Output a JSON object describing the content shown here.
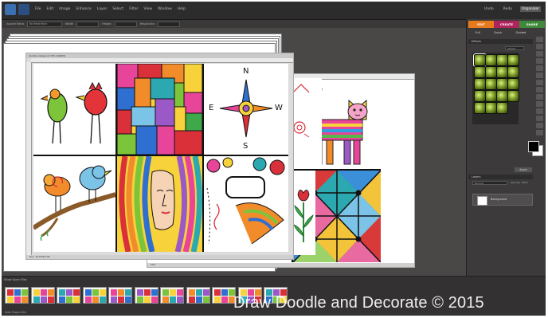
{
  "menu": {
    "items": [
      "File",
      "Edit",
      "Image",
      "Enhance",
      "Layer",
      "Select",
      "Filter",
      "View",
      "Window",
      "Help"
    ],
    "right": [
      "Undo",
      "Redo",
      "Organizer"
    ]
  },
  "options": {
    "fields": [
      {
        "label": "Aspect Ratio",
        "value": "No Restriction"
      },
      {
        "label": "Width",
        "value": "Width"
      },
      {
        "label": "Height",
        "value": "Height"
      },
      {
        "label": "Resolution",
        "value": "Resolution"
      }
    ]
  },
  "document": {
    "title": "doodle-collage @ 33% (RGB/8)",
    "status": "Doc: 16.7M/16.7M",
    "back_status": "33%"
  },
  "panel": {
    "modes": [
      {
        "label": "EDIT",
        "color": "#e87a1e"
      },
      {
        "label": "CREATE",
        "color": "#b0245c"
      },
      {
        "label": "SHARE",
        "color": "#3e8a3a"
      }
    ],
    "subtabs": [
      "Full",
      "Quick",
      "Guided"
    ],
    "effects_header": "Effects",
    "effects_category": "Artistic",
    "apply_label": "Apply",
    "layers_header": "Layers",
    "blend_mode": "Normal",
    "opacity": "Opacity: 100%",
    "layer_name": "Background"
  },
  "bin": {
    "header": "Show Open Files",
    "footer": "Hide Project Bin",
    "thumb_count": 11
  },
  "watermark": "Draw Doodle and Decorate © 2015",
  "compass": {
    "n": "N",
    "s": "S",
    "e": "E",
    "w": "W"
  }
}
